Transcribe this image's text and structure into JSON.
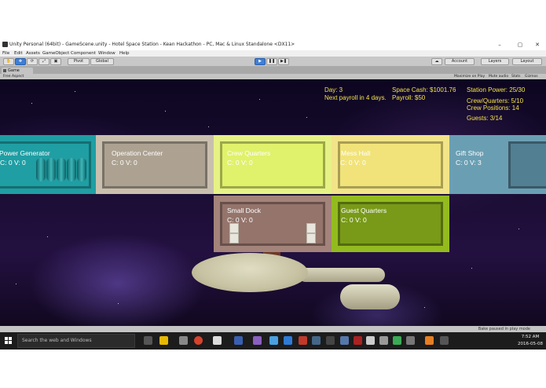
{
  "window": {
    "title": "Unity Personal (64bit) - GameScene.unity - Hotel Space Station - Kean Hackathon - PC, Mac & Linux Standalone <DX11>",
    "minimize": "–",
    "maximize": "▢",
    "close": "✕"
  },
  "menu": [
    "File",
    "Edit",
    "Assets",
    "GameObject",
    "Component",
    "Window",
    "Help"
  ],
  "toolbar": {
    "pivot": "Pivot",
    "global": "Global",
    "account": "Account",
    "layers": "Layers",
    "layout": "Layout"
  },
  "game_view": {
    "tab_label": "Game",
    "aspect": "Free Aspect",
    "toggles": [
      "Maximize on Play",
      "Mute audio",
      "Stats",
      "Gizmos"
    ]
  },
  "hud": {
    "day": "Day: 3",
    "payroll_notice": "Next payroll in 4 days.",
    "space_cash": "Space Cash: $1001.76",
    "payroll": "Payroll: $50",
    "station_power": "Station Power: 25/30",
    "crew_quarters": "Crew/Quarters: 5/10",
    "crew_positions": "Crew Positions: 14",
    "guests": "Guests: 3/14"
  },
  "rooms": [
    {
      "name": "Power Generator",
      "stats": "C: 0  V: 0",
      "color": "#1f9ea3"
    },
    {
      "name": "Operation Center",
      "stats": "C: 0  V: 0",
      "color": "#c9bfae"
    },
    {
      "name": "Crew Quarters",
      "stats": "C: 0  V: 0",
      "color": "#e6f286"
    },
    {
      "name": "Mess Hall",
      "stats": "C: 0  V: 0",
      "color": "#f2e488"
    },
    {
      "name": "Gift Shop",
      "stats": "C: 0  V: 3",
      "color": "#6a9fb3"
    },
    {
      "name": "Small Dock",
      "stats": "C: 0  V: 0",
      "color": "#a3837a"
    },
    {
      "name": "Guest Quarters",
      "stats": "C: 0  V: 0",
      "color": "#93bb1f"
    }
  ],
  "status_bar": {
    "message": "Bake paused in play mode"
  },
  "taskbar": {
    "search_placeholder": "Search the web and Windows",
    "time": "7:52 AM",
    "date": "2016-05-08"
  }
}
